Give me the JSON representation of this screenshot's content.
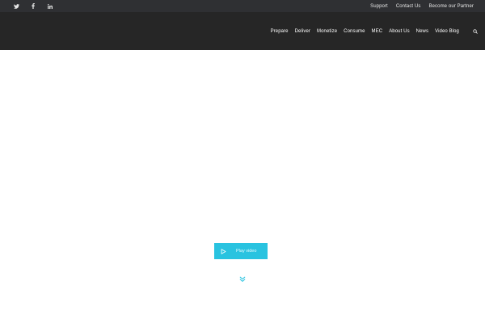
{
  "colors": {
    "topbar_bg": "#2f3033",
    "navbar_bg": "#262626",
    "accent": "#29c3e0",
    "text_light": "#ffffff"
  },
  "topbar": {
    "social_icons": [
      "twitter-icon",
      "facebook-icon",
      "linkedin-icon"
    ],
    "links": [
      "Support",
      "Contact Us",
      "Become our Partner"
    ]
  },
  "navbar": {
    "menu": [
      "Prepare",
      "Deliver",
      "Monetize",
      "Consume",
      "MEC",
      "About Us",
      "News",
      "Video Blog"
    ],
    "search_icon": "search-icon"
  },
  "hero": {
    "play_button_label": "Play video",
    "play_icon": "play-icon",
    "scroll_icon": "double-chevron-down-icon"
  }
}
